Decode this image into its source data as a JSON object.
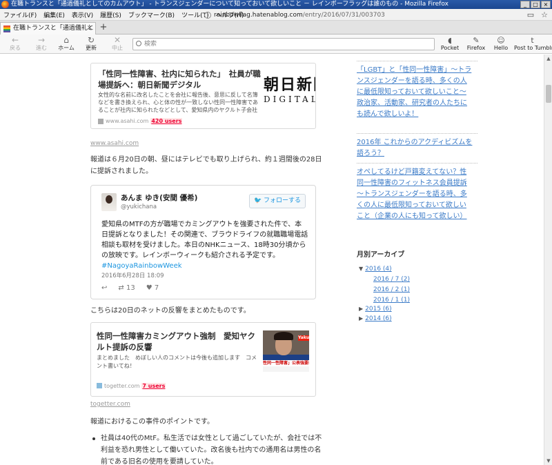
{
  "window": {
    "title": "在職トランスと「通過儀礼としてのカムアウト」 - トランスジェンダーについて知っておいて欲しいこと － レインボーフラッグは誰のもの - Mozilla Firefox",
    "controls": [
      "_",
      "□",
      "×"
    ]
  },
  "menubar": {
    "items": [
      "ファイル(F)",
      "編集(E)",
      "表示(V)",
      "履歴(S)",
      "ブックマーク(B)",
      "ツール(T)",
      "ヘルプ(H)"
    ],
    "url_host": "rainbowflag.hatenablog.com",
    "url_path": "/entry/2016/07/31/003703"
  },
  "tab": {
    "title": "在職トランスと「通過儀礼としての...",
    "close": "×",
    "new": "+"
  },
  "navbar": {
    "back": "戻る",
    "forward": "進む",
    "home": "ホーム",
    "reload": "更新",
    "stop": "中止",
    "search_placeholder": "検索",
    "pocket": "Pocket",
    "firefox": "Firefox",
    "hello": "Hello",
    "tumblr": "Post to Tumblr",
    "icon_colors": {
      "accent": "#1b95e0",
      "link": "#3a7ac7",
      "users": "#e00033"
    }
  },
  "article": {
    "asahi_card": {
      "title": "「性同一性障害、社内に知られた」　社員が職場提訴へ：朝日新聞デジタル",
      "desc": "女性的な名前に改名したことを会社に報告後、意思に反して名簿などを書き換えられ、心と体の性が一致しない性同一性障害であることが社内に知られたなどとして、愛知県内のヤクルト子会社社員",
      "source": "www.asahi.com",
      "users": "420 users",
      "logo_big": "朝日新聞",
      "logo_small": "DIGITAL"
    },
    "asahi_link": "www.asahi.com",
    "para1": "報道は６月20日の朝、昼にはテレビでも取り上げられ、約１週間後の28日に提訴されました。",
    "tweet": {
      "name": "あんま ゆき(安間 優希)",
      "handle": "@yukichana",
      "follow": "フォローする",
      "body": "愛知県のMTFの方が職場でカミングアウトを強要された件で、本日提訴となりました！その関連で、ブラウドライフの就職職場電話相談も取材を受けました。本日のNHKニュース、18時30分頃からの放映です。レインボーウィークも紹介される予定です。",
      "hashtag": "#NagoyaRainbowWeek",
      "date": "2016年6月28日 18:09",
      "retweets": "13",
      "likes": "7"
    },
    "para2": "こちらは20日のネットの反響をまとめたものです。",
    "togetter_card": {
      "title": "性同一性障害カミングアウト強制　愛知ヤクルト提訴の反響",
      "desc": "まとめました　めぼしい人のコメントは今後も追加します　コメント書いてね！",
      "source": "togetter.com",
      "users": "7 users",
      "thumb_tag": "Yaku",
      "thumb_caption": "性同一性障害」公表強要は不"
    },
    "togetter_link": "togetter.com",
    "para3": "報道におけるこの事件のポイントです。",
    "bullet1": "社員は40代のMtF。私生活では女性として過ごしていたが、会社では不利益を恐れ男性として働いていた。改名後も社内での通用名は男性の名前である旧名の使用を要請していた。"
  },
  "sidebar": {
    "links": [
      "「LGBT」と「性同一性障害」～トランスジェンダーを語る時、多くの人に最低限知っておいて欲しいこと～政治家、活動家、研究者の人たちにも読んで欲しいよ！",
      "2016年 これからのアクディビズムを語ろう？",
      "オペしてるけど戸籍変えてない？性同一性障害のフィットネス会員提訴～トランスジェンダーを語る時、多くの人に最低限知っておいて欲しいこと（企業の人にも知って欲しい）"
    ],
    "archive_title": "月別アーカイブ",
    "archive": [
      {
        "label": "2016 (4)",
        "expanded": true
      },
      {
        "label": "2016 / 7 (2)",
        "sub": true
      },
      {
        "label": "2016 / 2 (1)",
        "sub": true
      },
      {
        "label": "2016 / 1 (1)",
        "sub": true
      },
      {
        "label": "2015 (6)",
        "expanded": false
      },
      {
        "label": "2014 (6)",
        "expanded": false
      }
    ]
  }
}
